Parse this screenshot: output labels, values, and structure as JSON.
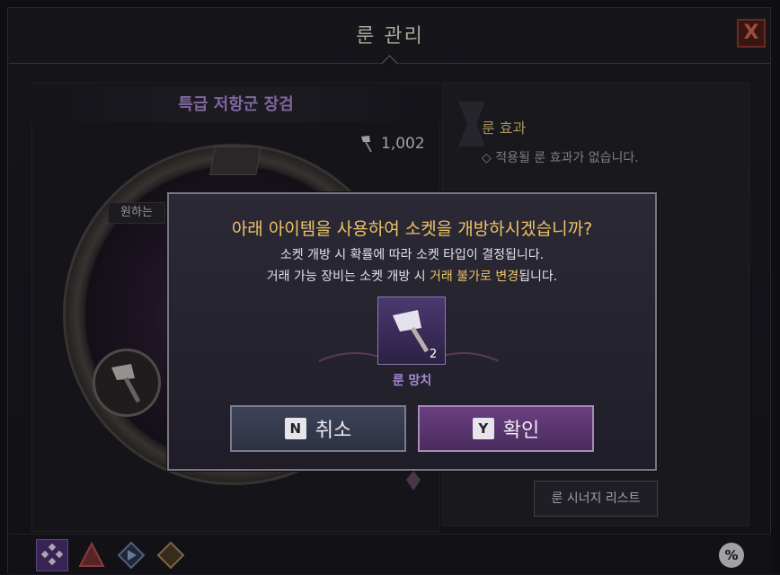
{
  "window": {
    "title": "룬 관리",
    "close_label": "X"
  },
  "left_panel": {
    "item_name": "특급 저항군 장검",
    "currency_value": "1,002",
    "side_label": "원하는"
  },
  "right_panel": {
    "rune_effect_title": "룬 효과",
    "rune_effect_empty": "◇ 적용될 룬 효과가 없습니다.",
    "synergy_button": "룬 시너지 리스트"
  },
  "bottom_bar": {
    "percent_label": "%"
  },
  "dialog": {
    "title": "아래 아이템을 사용하여 소켓을 개방하시겠습니까?",
    "line1": "소켓 개방 시 확률에 따라 소켓 타입이 결정됩니다.",
    "line2_prefix": "거래 가능 장비는 소켓 개방 시 ",
    "line2_highlight": "거래 불가로 변경",
    "line2_suffix": "됩니다.",
    "item_label": "룬 망치",
    "item_count": "2",
    "cancel_key": "N",
    "cancel_label": "취소",
    "confirm_key": "Y",
    "confirm_label": "확인"
  },
  "colors": {
    "accent_gold": "#eec365",
    "item_purple": "#a98ad6",
    "confirm_purple": "#6a3f80",
    "cancel_slate": "#3e4458"
  },
  "icons": {
    "currency": "rune-hammer-currency-icon",
    "item": "rune-hammer-icon",
    "close": "close-icon",
    "percent": "percent-icon"
  }
}
